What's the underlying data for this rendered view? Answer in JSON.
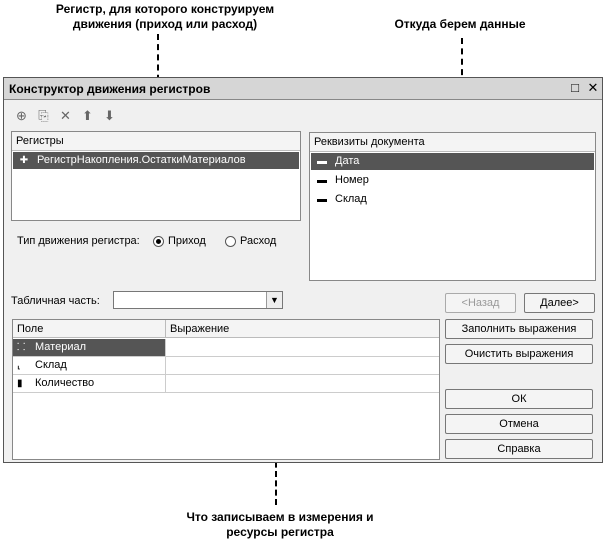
{
  "annotations": {
    "register": "Регистр, для которого конструируем движения (приход или расход)",
    "source": "Откуда берем данные",
    "target": "Что записываем в измерения и ресурсы регистра"
  },
  "window": {
    "title": "Конструктор движения регистров",
    "maximize_icon": "□",
    "close_icon": "✕"
  },
  "toolbar": {
    "add_icon": "⊕",
    "copy_icon": "⎘",
    "delete_icon": "✕",
    "up_icon": "⬆",
    "down_icon": "⬇"
  },
  "registers": {
    "header": "Регистры",
    "items": [
      {
        "label": "РегистрНакопления.ОстаткиМатериалов",
        "icon": "register-icon"
      }
    ]
  },
  "movement": {
    "label": "Тип движения регистра:",
    "options": [
      "Приход",
      "Расход"
    ],
    "selected": "Приход"
  },
  "requisites": {
    "header": "Реквизиты документа",
    "items": [
      {
        "label": "Дата"
      },
      {
        "label": "Номер"
      },
      {
        "label": "Склад"
      }
    ]
  },
  "table_part": {
    "label": "Табличная часть:",
    "value": ""
  },
  "grid": {
    "columns": [
      "Поле",
      "Выражение"
    ],
    "rows": [
      {
        "field": "Материал",
        "expr": ""
      },
      {
        "field": "Склад",
        "expr": ""
      },
      {
        "field": "Количество",
        "expr": ""
      }
    ]
  },
  "buttons": {
    "back": "<Назад",
    "next": "Далее>",
    "fill": "Заполнить выражения",
    "clear": "Очистить выражения",
    "ok": "ОК",
    "cancel": "Отмена",
    "help": "Справка"
  }
}
